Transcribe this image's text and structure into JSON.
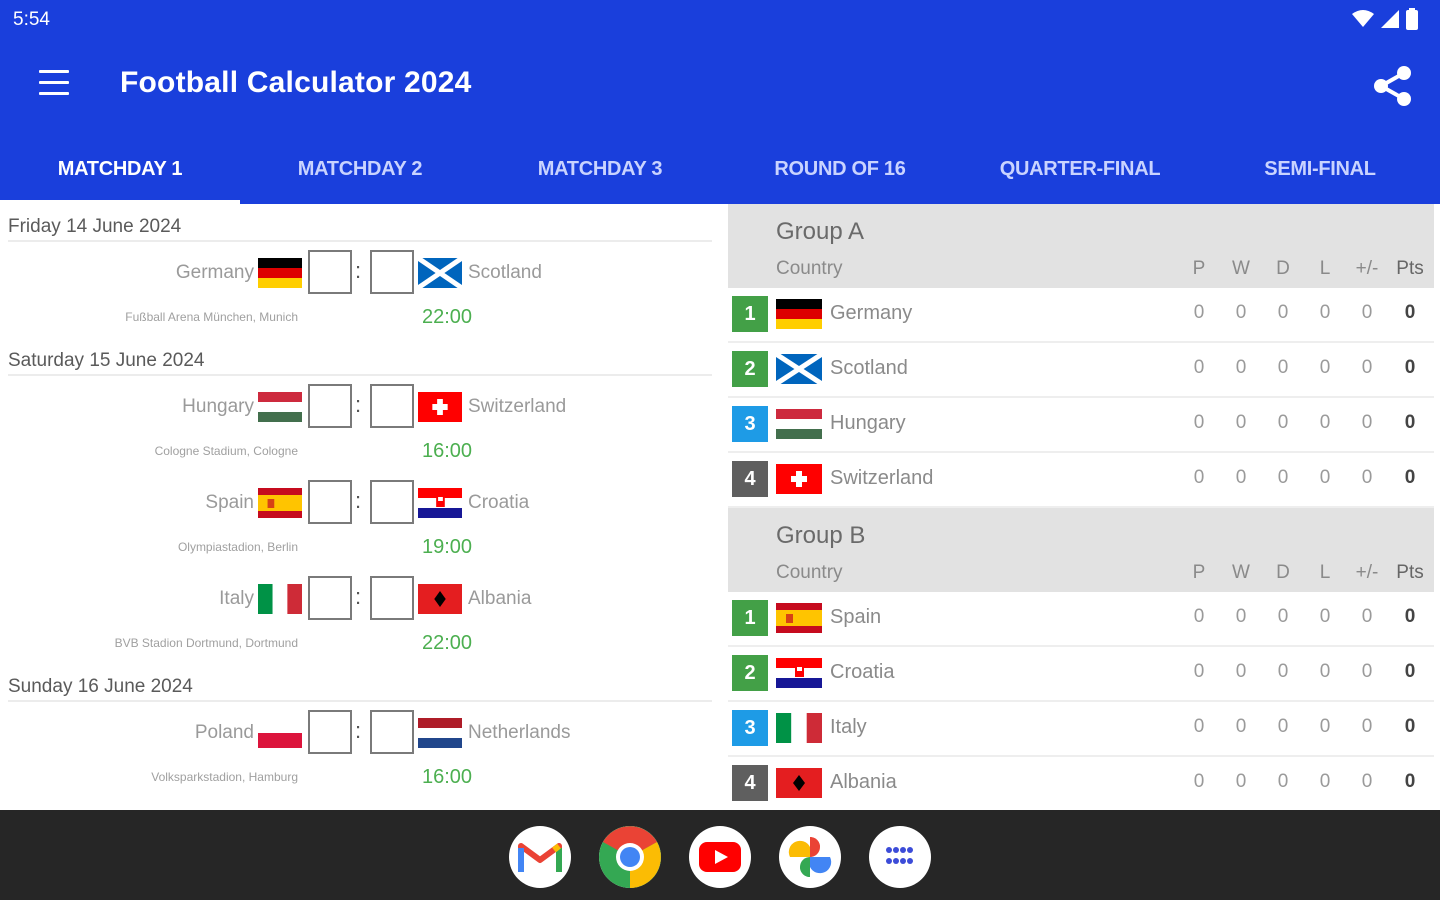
{
  "status": {
    "time": "5:54"
  },
  "app": {
    "title": "Football Calculator 2024"
  },
  "tabs": [
    {
      "label": "MATCHDAY 1",
      "active": true
    },
    {
      "label": "MATCHDAY 2"
    },
    {
      "label": "MATCHDAY 3"
    },
    {
      "label": "ROUND OF 16"
    },
    {
      "label": "QUARTER-FINAL"
    },
    {
      "label": "SEMI-FINAL"
    }
  ],
  "days": [
    {
      "date": "Friday 14 June 2024",
      "matches": [
        {
          "home": "Germany",
          "away": "Scotland",
          "venue": "Fußball Arena München, Munich",
          "time": "22:00"
        }
      ]
    },
    {
      "date": "Saturday 15 June 2024",
      "matches": [
        {
          "home": "Hungary",
          "away": "Switzerland",
          "venue": "Cologne Stadium, Cologne",
          "time": "16:00"
        },
        {
          "home": "Spain",
          "away": "Croatia",
          "venue": "Olympiastadion, Berlin",
          "time": "19:00"
        },
        {
          "home": "Italy",
          "away": "Albania",
          "venue": "BVB Stadion Dortmund, Dortmund",
          "time": "22:00"
        }
      ]
    },
    {
      "date": "Sunday 16 June 2024",
      "matches": [
        {
          "home": "Poland",
          "away": "Netherlands",
          "venue": "Volksparkstadion, Hamburg",
          "time": "16:00"
        }
      ]
    }
  ],
  "table_headers": {
    "country": "Country",
    "cols": [
      "P",
      "W",
      "D",
      "L",
      "+/-",
      "Pts"
    ]
  },
  "groups": [
    {
      "name": "Group A",
      "rows": [
        {
          "pos": "1",
          "team": "Germany",
          "stats": [
            "0",
            "0",
            "0",
            "0",
            "0",
            "0"
          ]
        },
        {
          "pos": "2",
          "team": "Scotland",
          "stats": [
            "0",
            "0",
            "0",
            "0",
            "0",
            "0"
          ]
        },
        {
          "pos": "3",
          "team": "Hungary",
          "stats": [
            "0",
            "0",
            "0",
            "0",
            "0",
            "0"
          ]
        },
        {
          "pos": "4",
          "team": "Switzerland",
          "stats": [
            "0",
            "0",
            "0",
            "0",
            "0",
            "0"
          ]
        }
      ]
    },
    {
      "name": "Group B",
      "rows": [
        {
          "pos": "1",
          "team": "Spain",
          "stats": [
            "0",
            "0",
            "0",
            "0",
            "0",
            "0"
          ]
        },
        {
          "pos": "2",
          "team": "Croatia",
          "stats": [
            "0",
            "0",
            "0",
            "0",
            "0",
            "0"
          ]
        },
        {
          "pos": "3",
          "team": "Italy",
          "stats": [
            "0",
            "0",
            "0",
            "0",
            "0",
            "0"
          ]
        },
        {
          "pos": "4",
          "team": "Albania",
          "stats": [
            "0",
            "0",
            "0",
            "0",
            "0",
            "0"
          ]
        }
      ]
    }
  ],
  "position_colors": {
    "1": "#43a047",
    "2": "#43a047",
    "3": "#1e9be6",
    "4": "#5f5f5f"
  },
  "theme": {
    "primary": "#1a3fdc",
    "time_color": "#4caf50"
  },
  "dock": [
    "gmail-icon",
    "chrome-icon",
    "youtube-icon",
    "photos-icon",
    "apps-icon"
  ]
}
